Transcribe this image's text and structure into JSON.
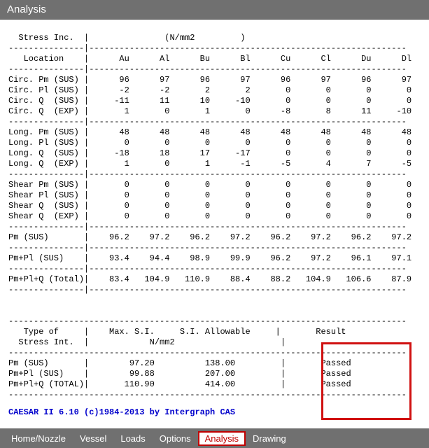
{
  "window": {
    "title": "Analysis"
  },
  "report": {
    "header_trunc_left": "  Stress Inc.  |",
    "header_trunc_right": "(N/mm2         )",
    "sep": "---------------|---------------------------------------------------------------",
    "sep_sum": "-------------------------------------------------------------------------------",
    "col_header": "   Location    |      Au      Al      Bu      Bl      Cu      Cl      Du      Dl",
    "rows_group1": [
      "Circ. Pm (SUS) |      96      97      96      97      96      97      96      97",
      "Circ. Pl (SUS) |      -2      -2       2       2       0       0       0       0",
      "Circ. Q  (SUS) |     -11      11      10     -10       0       0       0       0",
      "Circ. Q  (EXP) |       1       0       1       0      -8       8      11     -10"
    ],
    "rows_group2": [
      "Long. Pm (SUS) |      48      48      48      48      48      48      48      48",
      "Long. Pl (SUS) |       0       0       0       0       0       0       0       0",
      "Long. Q  (SUS) |     -18      18      17     -17       0       0       0       0",
      "Long. Q  (EXP) |       1       0       1      -1      -5       4       7      -5"
    ],
    "rows_group3": [
      "Shear Pm (SUS) |       0       0       0       0       0       0       0       0",
      "Shear Pl (SUS) |       0       0       0       0       0       0       0       0",
      "Shear Q  (SUS) |       0       0       0       0       0       0       0       0",
      "Shear Q  (EXP) |       0       0       0       0       0       0       0       0"
    ],
    "rows_totals": [
      "Pm (SUS)       |    96.2    97.2    96.2    97.2    96.2    97.2    96.2    97.2",
      "Pm+Pl (SUS)    |    93.4    94.4    98.9    99.9    96.2    97.2    96.1    97.1",
      "Pm+Pl+Q (Total)|    83.4   104.9   110.9    88.4    88.2   104.9   106.6    87.9"
    ],
    "summary_header1": "   Type of     |    Max. S.I.     S.I. Allowable     |       Result",
    "summary_header2": "  Stress Int.  |            N/mm2                     |",
    "summary_rows": [
      "Pm (SUS)       |        97.20          138.00         |       Passed",
      "Pm+Pl (SUS)    |        99.88          207.00         |       Passed",
      "Pm+Pl+Q (TOTAL)|       110.90          414.00         |       Passed"
    ]
  },
  "footer_text": "CAESAR II 6.10 (c)1984-2013 by Intergraph CAS",
  "tabs": [
    {
      "label": "Home/Nozzle",
      "active": false
    },
    {
      "label": "Vessel",
      "active": false
    },
    {
      "label": "Loads",
      "active": false
    },
    {
      "label": "Options",
      "active": false
    },
    {
      "label": "Analysis",
      "active": true
    },
    {
      "label": "Drawing",
      "active": false
    }
  ]
}
